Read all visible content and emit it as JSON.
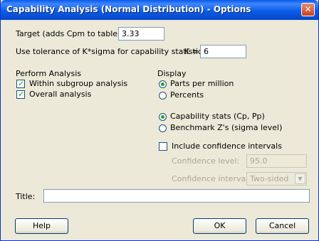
{
  "window": {
    "title": "Capability Analysis (Normal Distribution) - Options",
    "close_icon": "close-icon"
  },
  "target": {
    "label": "Target (adds Cpm to table):",
    "value": "3.33"
  },
  "tolerance": {
    "label": "Use tolerance of K*sigma for capability statistics",
    "k_label": "K =",
    "value": "6"
  },
  "perform": {
    "heading": "Perform Analysis",
    "within": {
      "label": "Within subgroup analysis",
      "checked": true
    },
    "overall": {
      "label": "Overall analysis",
      "checked": true
    }
  },
  "display": {
    "heading": "Display",
    "units": {
      "options": [
        "Parts per million",
        "Percents"
      ],
      "selected": "Parts per million"
    },
    "stats": {
      "options": [
        "Capability stats (Cp, Pp)",
        "Benchmark Z's (sigma level)"
      ],
      "selected": "Capability stats (Cp, Pp)"
    },
    "confidence": {
      "label": "Include confidence intervals",
      "checked": false,
      "level_label": "Confidence level:",
      "level_value": "95.0",
      "intervals_label": "Confidence intervals:",
      "intervals_value": "Two-sided"
    }
  },
  "title_field": {
    "label": "Title:",
    "value": ""
  },
  "buttons": {
    "help": "Help",
    "ok": "OK",
    "cancel": "Cancel"
  }
}
